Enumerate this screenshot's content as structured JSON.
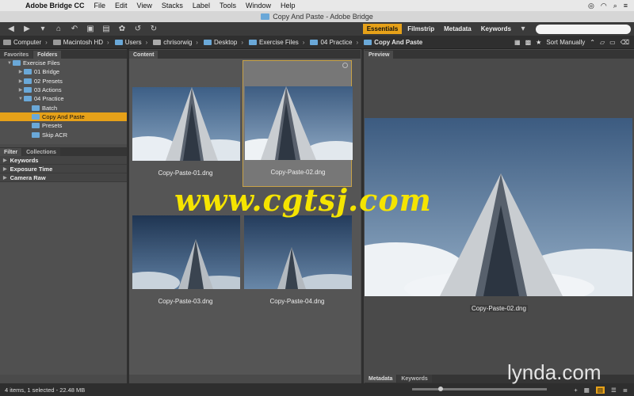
{
  "menubar": {
    "app": "Adobe Bridge CC",
    "items": [
      "File",
      "Edit",
      "View",
      "Stacks",
      "Label",
      "Tools",
      "Window",
      "Help"
    ]
  },
  "window": {
    "title": "Copy And Paste - Adobe Bridge"
  },
  "toolbar": {
    "workspaces": [
      "Essentials",
      "Filmstrip",
      "Metadata",
      "Keywords"
    ],
    "active_workspace": "Essentials",
    "search_placeholder": ""
  },
  "breadcrumb": [
    "Computer",
    "Macintosh HD",
    "Users",
    "chrisorwig",
    "Desktop",
    "Exercise Files",
    "04 Practice",
    "Copy And Paste"
  ],
  "sort": {
    "label": "Sort Manually"
  },
  "left_panel": {
    "tabs": [
      "Favorites",
      "Folders"
    ],
    "active_tab": "Folders",
    "folders": [
      {
        "label": "Exercise Files",
        "level": 1,
        "expanded": true
      },
      {
        "label": "01 Bridge",
        "level": 2
      },
      {
        "label": "02 Presets",
        "level": 2
      },
      {
        "label": "03 Actions",
        "level": 2
      },
      {
        "label": "04 Practice",
        "level": 2,
        "expanded": true
      },
      {
        "label": "Batch",
        "level": 3
      },
      {
        "label": "Copy And Paste",
        "level": 3,
        "selected": true
      },
      {
        "label": "Presets",
        "level": 3
      },
      {
        "label": "Skip ACR",
        "level": 3
      }
    ]
  },
  "filter_panel": {
    "tabs": [
      "Filter",
      "Collections"
    ],
    "active_tab": "Filter",
    "sections": [
      "Keywords",
      "Exposure Time",
      "Camera Raw"
    ]
  },
  "content": {
    "title": "Content",
    "items": [
      {
        "name": "Copy-Paste-01.dng",
        "selected": false
      },
      {
        "name": "Copy-Paste-02.dng",
        "selected": true
      },
      {
        "name": "Copy-Paste-03.dng",
        "selected": false
      },
      {
        "name": "Copy-Paste-04.dng",
        "selected": false
      }
    ]
  },
  "preview": {
    "title": "Preview",
    "caption": "Copy-Paste-02.dng"
  },
  "bottom_tabs": [
    "Metadata",
    "Keywords"
  ],
  "status": {
    "text": "4 items, 1 selected - 22.48 MB"
  },
  "zoom": {
    "level": 0.2
  },
  "watermark": {
    "text": "www.cgtsj.com"
  },
  "brand": {
    "text": "lynda.com"
  },
  "colors": {
    "accent": "#e6a119",
    "folder": "#6aa8d8",
    "watermark": "#f5e400"
  }
}
